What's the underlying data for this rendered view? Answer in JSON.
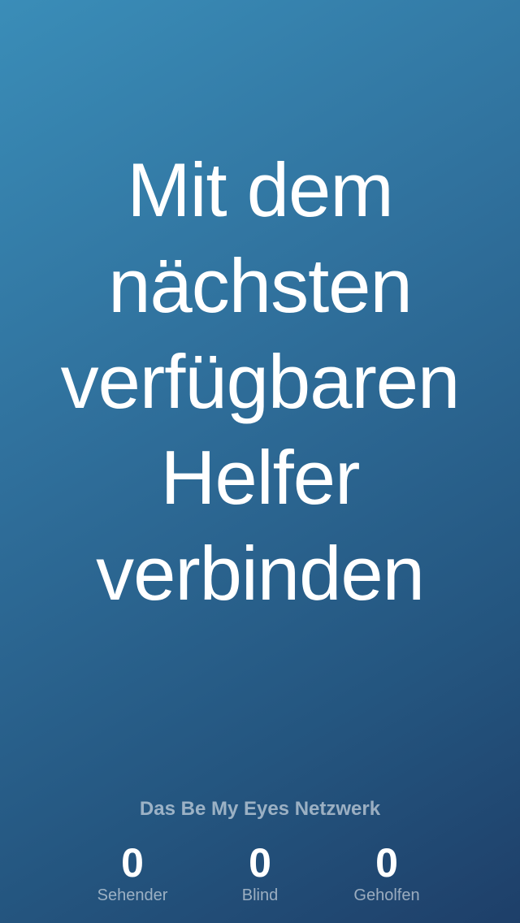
{
  "main": {
    "connect_lines": [
      "Mit dem",
      "nächsten",
      "verfügbaren",
      "Helfer",
      "verbinden"
    ]
  },
  "network": {
    "title": "Das Be My Eyes Netzwerk",
    "stats": [
      {
        "value": "0",
        "label": "Sehender"
      },
      {
        "value": "0",
        "label": "Blind"
      },
      {
        "value": "0",
        "label": "Geholfen"
      }
    ]
  },
  "colors": {
    "gradient_start": "#3a8db8",
    "gradient_end": "#1e3f69",
    "text": "#ffffff"
  }
}
